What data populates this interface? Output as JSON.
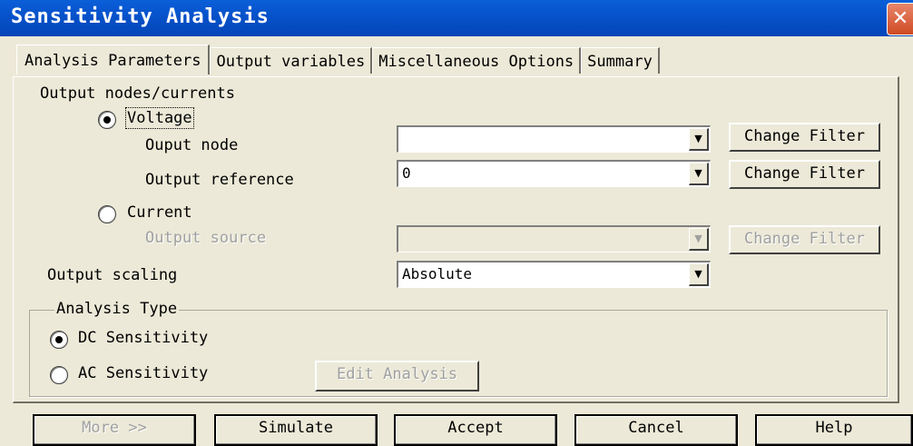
{
  "window": {
    "title": "Sensitivity Analysis",
    "close_glyph": "✕"
  },
  "tabs": [
    {
      "label": "Analysis Parameters"
    },
    {
      "label": "Output variables"
    },
    {
      "label": "Miscellaneous Options"
    },
    {
      "label": "Summary"
    }
  ],
  "output": {
    "section_label": "Output nodes/currents",
    "voltage_label": "Voltage",
    "voltage_selected": true,
    "output_node_label": "Ouput node",
    "output_node_value": "",
    "output_reference_label": "Output reference",
    "output_reference_value": "0",
    "current_label": "Current",
    "current_selected": false,
    "output_source_label": "Output source",
    "output_source_value": "",
    "change_filter_label": "Change Filter",
    "scaling_label": "Output scaling",
    "scaling_value": "Absolute"
  },
  "analysis_type": {
    "group_label": "Analysis Type",
    "dc_label": "DC Sensitivity",
    "dc_selected": true,
    "ac_label": "AC Sensitivity",
    "ac_selected": false,
    "edit_label": "Edit Analysis"
  },
  "footer": {
    "more_label": "More >>",
    "simulate_label": "Simulate",
    "accept_label": "Accept",
    "cancel_label": "Cancel",
    "help_label": "Help"
  },
  "dropdown_glyph": "▼"
}
